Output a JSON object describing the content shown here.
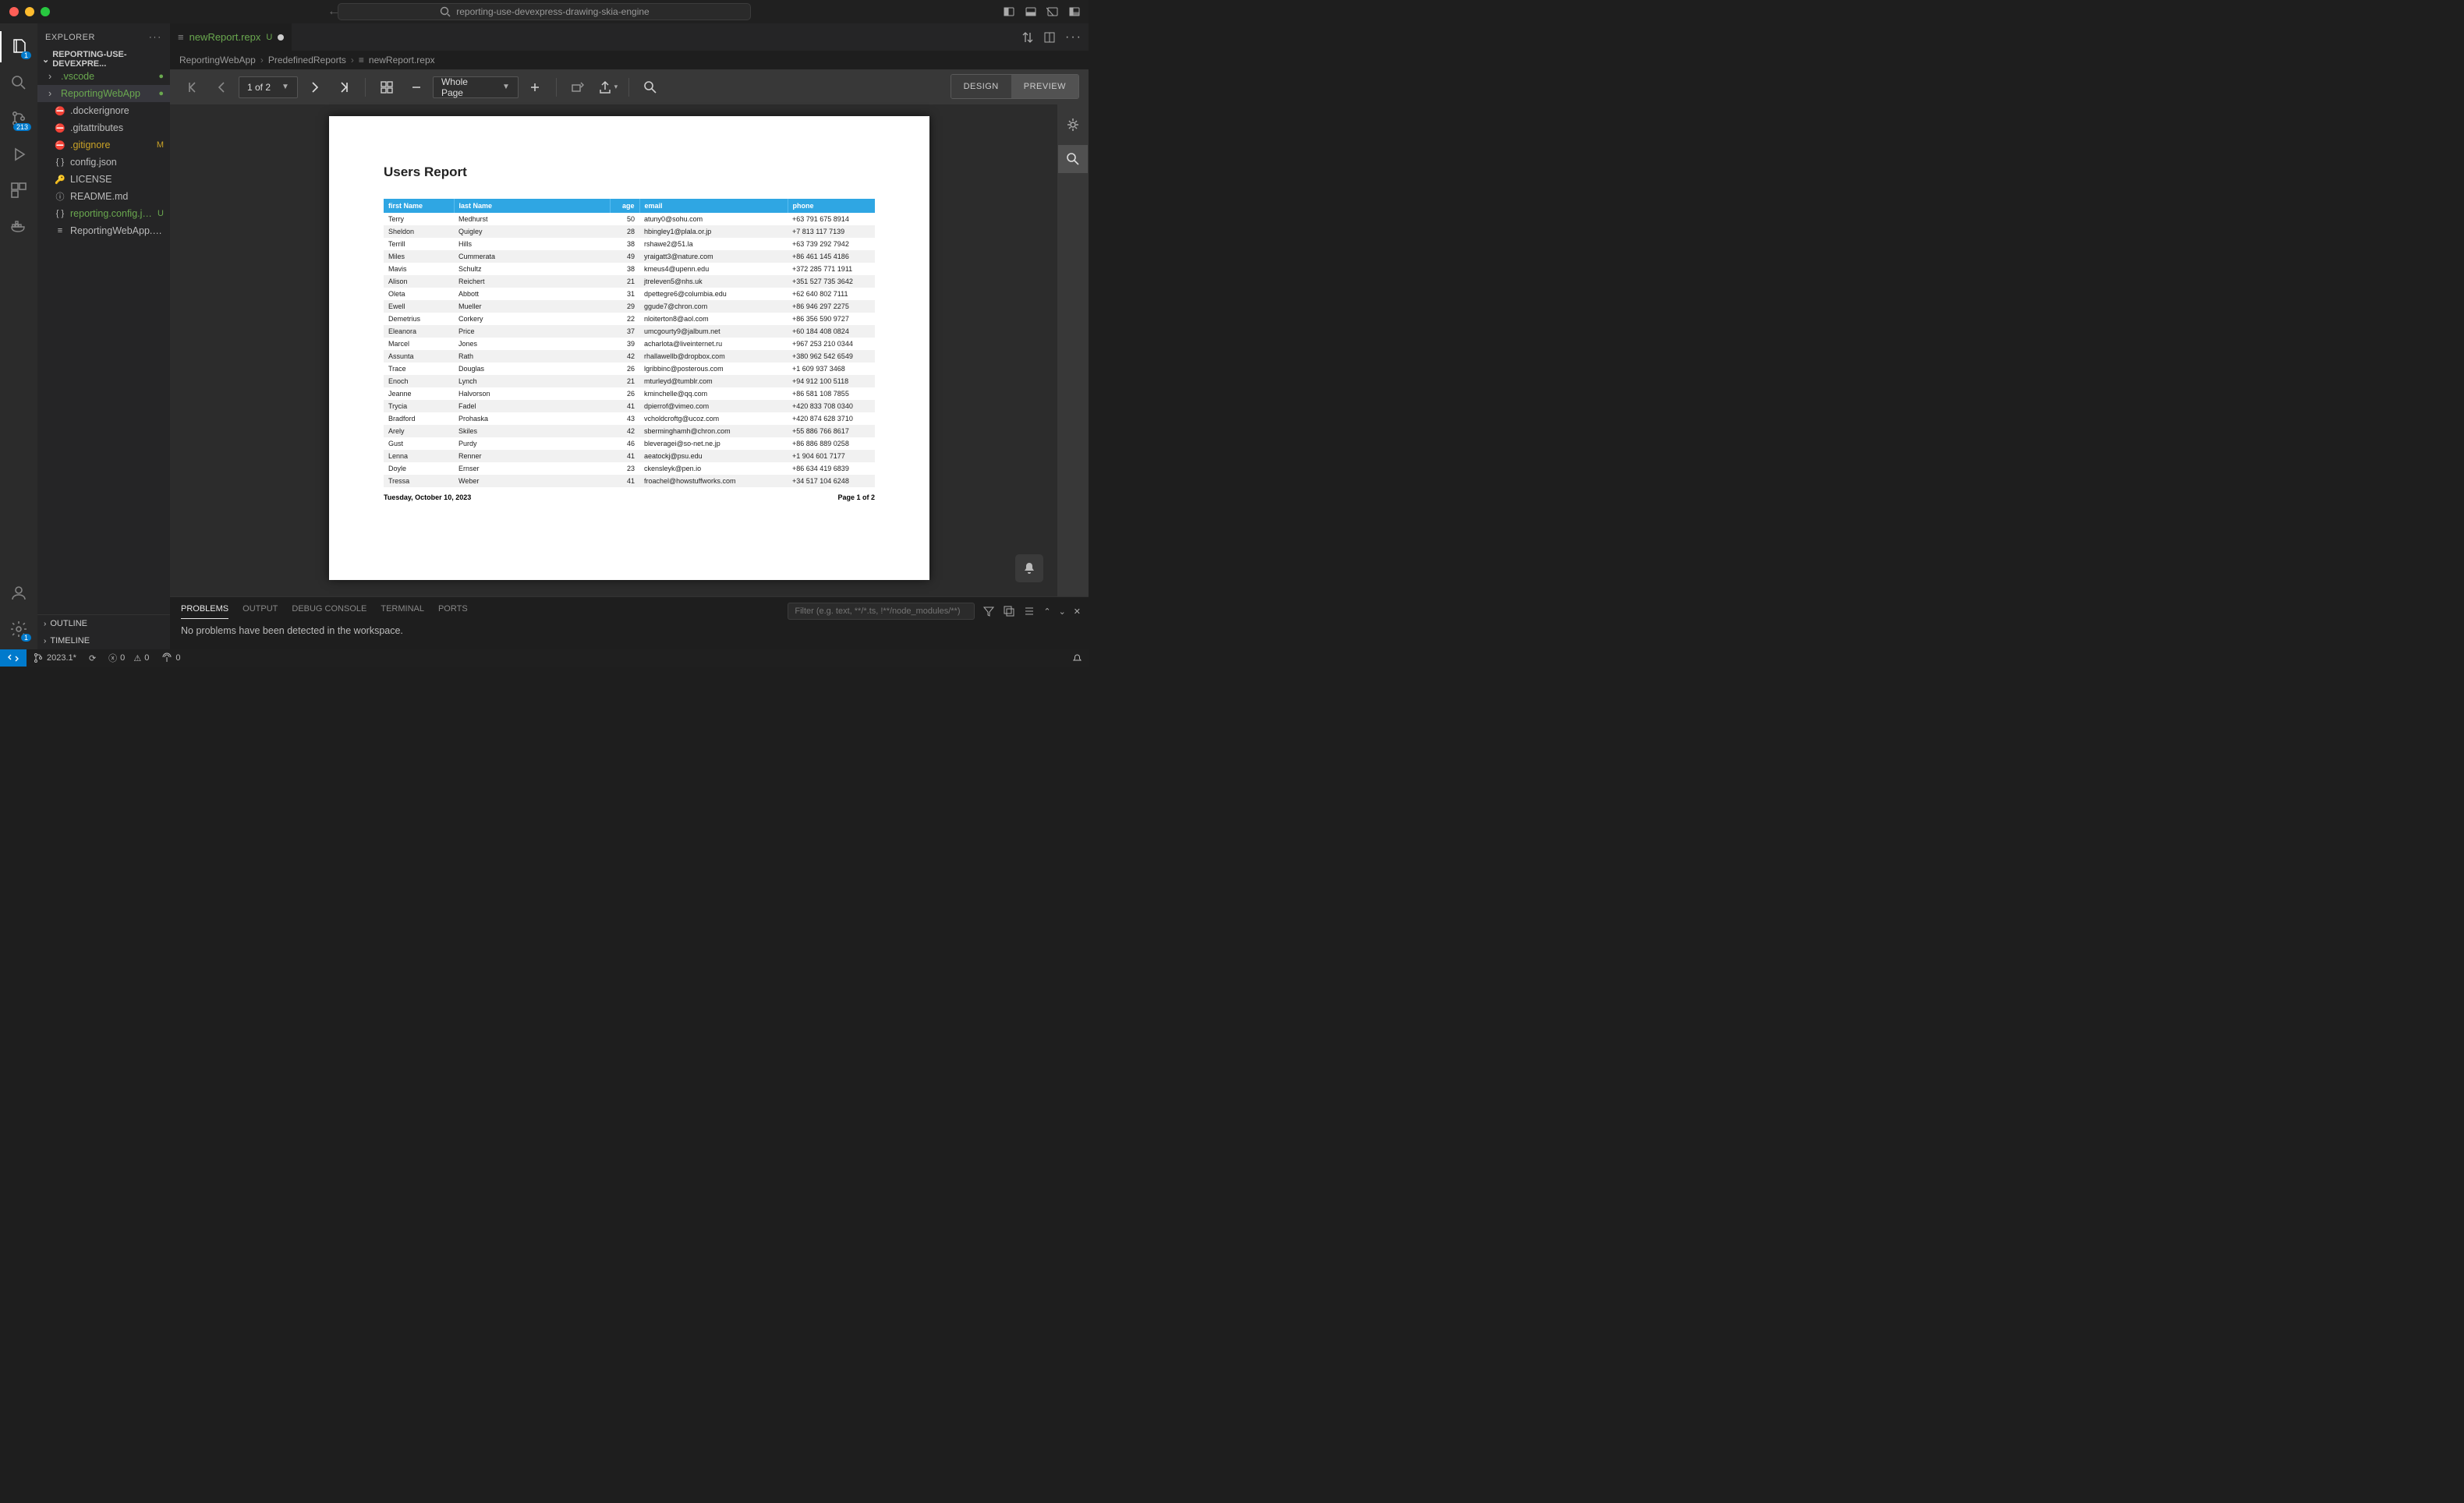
{
  "titlebar": {
    "project": "reporting-use-devexpress-drawing-skia-engine"
  },
  "activity": {
    "scm_badge": "213",
    "profile_badge": "1",
    "explorer_badge": "1"
  },
  "sidebar": {
    "title": "EXPLORER",
    "root": "REPORTING-USE-DEVEXPRE...",
    "items": [
      {
        "name": ".vscode",
        "folder": true,
        "status": "●",
        "cls": "fgreen"
      },
      {
        "name": "ReportingWebApp",
        "folder": true,
        "status": "●",
        "cls": "fgreen",
        "sel": true
      },
      {
        "name": ".dockerignore",
        "ic": "⛔"
      },
      {
        "name": ".gitattributes",
        "ic": "⛔"
      },
      {
        "name": ".gitignore",
        "ic": "⛔",
        "status": "M",
        "cls": "fyellow"
      },
      {
        "name": "config.json",
        "ic": "{ }"
      },
      {
        "name": "LICENSE",
        "ic": "🔑"
      },
      {
        "name": "README.md",
        "ic": "ⓘ"
      },
      {
        "name": "reporting.config.json",
        "ic": "{ }",
        "status": "U",
        "cls": "fgreen"
      },
      {
        "name": "ReportingWebApp.sln",
        "ic": "≡"
      }
    ],
    "outline": "OUTLINE",
    "timeline": "TIMELINE"
  },
  "tab": {
    "name": "newReport.repx",
    "status": "U"
  },
  "breadcrumbs": [
    "ReportingWebApp",
    "PredefinedReports",
    "newReport.repx"
  ],
  "report_toolbar": {
    "page_sel": "1 of 2",
    "zoom_sel": "Whole Page",
    "design": "DESIGN",
    "preview": "PREVIEW"
  },
  "chart_data": {
    "type": "table",
    "title": "Users Report",
    "columns": [
      "first Name",
      "last Name",
      "age",
      "email",
      "phone"
    ],
    "rows": [
      [
        "Terry",
        "Medhurst",
        "50",
        "atuny0@sohu.com",
        "+63 791 675 8914"
      ],
      [
        "Sheldon",
        "Quigley",
        "28",
        "hbingley1@plala.or.jp",
        "+7 813 117 7139"
      ],
      [
        "Terrill",
        "Hills",
        "38",
        "rshawe2@51.la",
        "+63 739 292 7942"
      ],
      [
        "Miles",
        "Cummerata",
        "49",
        "yraigatt3@nature.com",
        "+86 461 145 4186"
      ],
      [
        "Mavis",
        "Schultz",
        "38",
        "kmeus4@upenn.edu",
        "+372 285 771 1911"
      ],
      [
        "Alison",
        "Reichert",
        "21",
        "jtreleven5@nhs.uk",
        "+351 527 735 3642"
      ],
      [
        "Oleta",
        "Abbott",
        "31",
        "dpettegre6@columbia.edu",
        "+62 640 802 7111"
      ],
      [
        "Ewell",
        "Mueller",
        "29",
        "ggude7@chron.com",
        "+86 946 297 2275"
      ],
      [
        "Demetrius",
        "Corkery",
        "22",
        "nloiterton8@aol.com",
        "+86 356 590 9727"
      ],
      [
        "Eleanora",
        "Price",
        "37",
        "umcgourty9@jalbum.net",
        "+60 184 408 0824"
      ],
      [
        "Marcel",
        "Jones",
        "39",
        "acharlota@liveinternet.ru",
        "+967 253 210 0344"
      ],
      [
        "Assunta",
        "Rath",
        "42",
        "rhallawellb@dropbox.com",
        "+380 962 542 6549"
      ],
      [
        "Trace",
        "Douglas",
        "26",
        "lgribbinc@posterous.com",
        "+1 609 937 3468"
      ],
      [
        "Enoch",
        "Lynch",
        "21",
        "mturleyd@tumblr.com",
        "+94 912 100 5118"
      ],
      [
        "Jeanne",
        "Halvorson",
        "26",
        "kminchelle@qq.com",
        "+86 581 108 7855"
      ],
      [
        "Trycia",
        "Fadel",
        "41",
        "dpierrof@vimeo.com",
        "+420 833 708 0340"
      ],
      [
        "Bradford",
        "Prohaska",
        "43",
        "vcholdcroftg@ucoz.com",
        "+420 874 628 3710"
      ],
      [
        "Arely",
        "Skiles",
        "42",
        "sberminghamh@chron.com",
        "+55 886 766 8617"
      ],
      [
        "Gust",
        "Purdy",
        "46",
        "bleveragei@so-net.ne.jp",
        "+86 886 889 0258"
      ],
      [
        "Lenna",
        "Renner",
        "41",
        "aeatockj@psu.edu",
        "+1 904 601 7177"
      ],
      [
        "Doyle",
        "Ernser",
        "23",
        "ckensleyk@pen.io",
        "+86 634 419 6839"
      ],
      [
        "Tressa",
        "Weber",
        "41",
        "froachel@howstuffworks.com",
        "+34 517 104 6248"
      ]
    ],
    "footer_date": "Tuesday, October 10, 2023",
    "footer_page": "Page 1 of 2"
  },
  "panel": {
    "tabs": [
      "PROBLEMS",
      "OUTPUT",
      "DEBUG CONSOLE",
      "TERMINAL",
      "PORTS"
    ],
    "filter_ph": "Filter (e.g. text, **/*.ts, !**/node_modules/**)",
    "body": "No problems have been detected in the workspace."
  },
  "status": {
    "branch": "2023.1*",
    "sync": "⟳",
    "err": "0",
    "warn": "0",
    "ports_ic": "⇅ 0"
  }
}
